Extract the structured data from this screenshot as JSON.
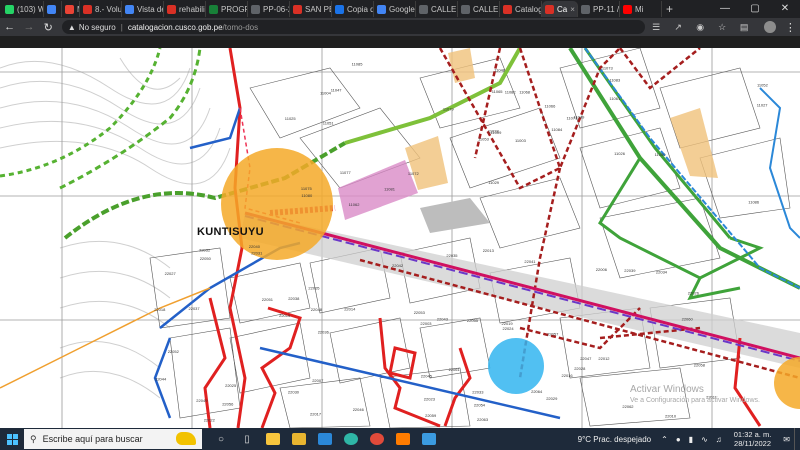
{
  "browser": {
    "tabs": [
      {
        "label": "(103) W",
        "color": "#25d366"
      },
      {
        "label": "",
        "color": "#4285f4"
      },
      {
        "label": "M",
        "color": "#ea4335"
      },
      {
        "label": "8.- Volu",
        "color": "#d93025"
      },
      {
        "label": "Vista de",
        "color": "#4285f4"
      },
      {
        "label": "rehabili",
        "color": "#d93025"
      },
      {
        "label": "PROGR",
        "color": "#188038"
      },
      {
        "label": "PP-06-2",
        "color": "#5f6368"
      },
      {
        "label": "SAN PE",
        "color": "#d93025"
      },
      {
        "label": "Copia d",
        "color": "#1a73e8"
      },
      {
        "label": "Google",
        "color": "#4285f4"
      },
      {
        "label": "CALLE C",
        "color": "#5f6368"
      },
      {
        "label": "CALLE C",
        "color": "#5f6368"
      },
      {
        "label": "Catalog",
        "color": "#d93025"
      },
      {
        "label": "Ca",
        "color": "#d93025",
        "active": true
      },
      {
        "label": "PP-11 /",
        "color": "#5f6368"
      },
      {
        "label": "Mi",
        "color": "#ff0000"
      }
    ],
    "new_tab": "+",
    "window_controls": {
      "minimize": "—",
      "maximize": "▢",
      "close": "✕"
    },
    "security_label": "No seguro",
    "url_host": "catalogacion.cusco.gob.pe",
    "url_path": "/tomo-dos"
  },
  "map": {
    "place_label": "KUNTISUYU",
    "watermark_line1": "Activar Windows",
    "watermark_line2": "Ve a Configuración para activar Windows.",
    "lot_labels": [
      "11003",
      "11004",
      "11009",
      "11075",
      "11071",
      "11072",
      "11073",
      "11068",
      "11083",
      "11084",
      "11085",
      "11086",
      "11051",
      "11052",
      "11053",
      "11061",
      "11062",
      "11065",
      "11066",
      "11077",
      "11079",
      "11080",
      "11081",
      "11082",
      "11049",
      "11050",
      "11047",
      "11048",
      "11025",
      "11026",
      "11027",
      "11028",
      "11029",
      "22003",
      "22005",
      "22006",
      "22007",
      "22010",
      "22011",
      "22012",
      "22013",
      "22014",
      "22015",
      "22016",
      "22017",
      "22018",
      "22019",
      "22022",
      "22023",
      "22024",
      "22025",
      "22026",
      "22027",
      "22028",
      "22029",
      "22030",
      "22031",
      "22032",
      "22033",
      "22034",
      "22035",
      "22036",
      "22037",
      "22038",
      "22039",
      "22040",
      "22041",
      "22042",
      "22043",
      "22044",
      "22045",
      "22046",
      "22047",
      "22048",
      "22049",
      "22050",
      "22051",
      "22052",
      "22053",
      "22054",
      "22055",
      "22056",
      "22057",
      "22058",
      "22059",
      "22060",
      "22061",
      "22062",
      "22063",
      "22064"
    ]
  },
  "taskbar": {
    "search_placeholder": "Escribe aquí para buscar",
    "weather": "9°C  Prac. despejado",
    "time": "01:32 a. m.",
    "date": "28/11/2022"
  }
}
